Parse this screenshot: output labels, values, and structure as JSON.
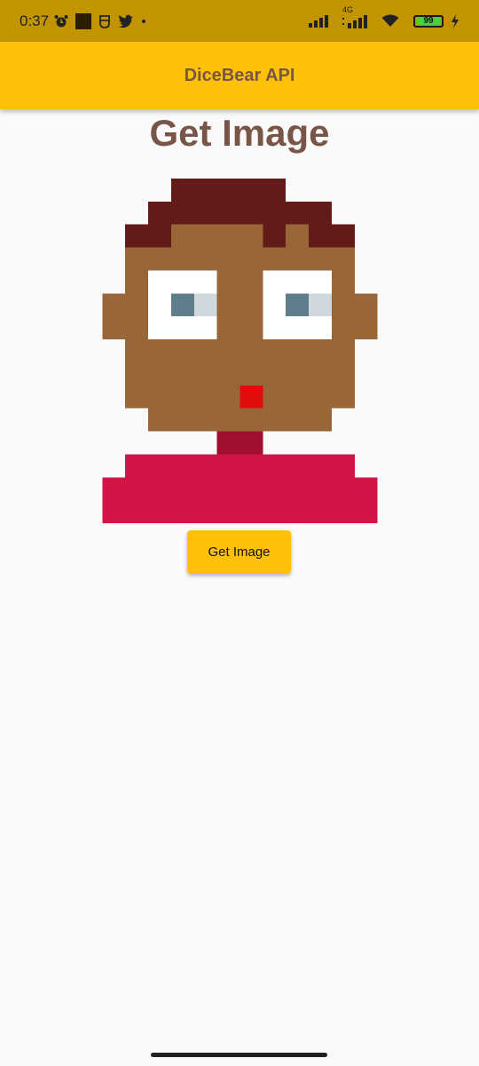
{
  "status_bar": {
    "time": "0:37",
    "network_type": "4G",
    "battery_level": "99",
    "icons": [
      "alarm-icon",
      "stop-icon",
      "shield-app-icon",
      "twitter-icon",
      "dot-icon",
      "signal-icon",
      "signal-4g-icon",
      "wifi-icon",
      "battery-icon",
      "charging-icon"
    ]
  },
  "app_bar": {
    "title": "DiceBear API"
  },
  "main": {
    "heading": "Get Image",
    "button_label": "Get Image",
    "avatar": {
      "style": "pixel-art",
      "colors": {
        "hair": "#621b19",
        "skin": "#996638",
        "eye_white": "#ffffff",
        "pupil": "#607d8b",
        "iris_light": "#cfd8dc",
        "mouth": "#e20c0c",
        "neck": "#a00f30",
        "shirt": "#d31345"
      }
    }
  },
  "colors": {
    "status_bar": "#c19400",
    "app_bar": "#ffc107",
    "title_text": "#795548",
    "background": "#fafafa"
  }
}
